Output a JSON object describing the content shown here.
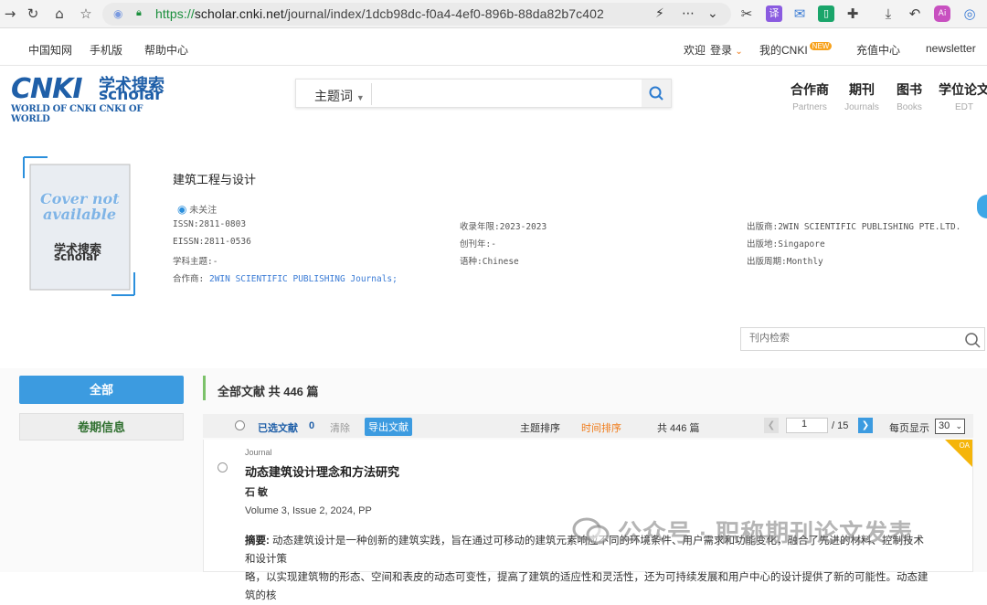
{
  "browser": {
    "url_proto": "https://",
    "url_host": "scholar.cnki.net",
    "url_path": "/journal/index/1dcb98dc-f0a4-4ef0-896b-88da82b7c402"
  },
  "topnav": {
    "items": [
      "中国知网",
      "手机版",
      "帮助中心"
    ],
    "welcome": "欢迎",
    "login": "登录",
    "mycnki": "我的CNKI",
    "new_badge": "NEW",
    "recharge": "充值中心",
    "newsletter": "newsletter"
  },
  "logo": {
    "main": "CNKI",
    "cn": "学术搜索",
    "sub": "scholar",
    "tagline": "WORLD OF CNKI CNKI OF WORLD"
  },
  "search": {
    "type": "主题词",
    "placeholder": ""
  },
  "nav_tabs": [
    {
      "cn": "合作商",
      "en": "Partners"
    },
    {
      "cn": "期刊",
      "en": "Journals"
    },
    {
      "cn": "图书",
      "en": "Books"
    },
    {
      "cn": "学位论文",
      "en": "EDT"
    }
  ],
  "cover": {
    "line1": "Cover not",
    "line2": "available",
    "logo_cn": "学术搜索",
    "logo_en": "scholar"
  },
  "journal": {
    "title": "建筑工程与设计",
    "follow": "未关注",
    "issn": "ISSN:2811-0803",
    "eissn": "EISSN:2811-0536",
    "subject": "学科主题:-",
    "partner_label": "合作商:",
    "partner_value": "2WIN SCIENTIFIC PUBLISHING Journals;",
    "years": "收录年限:2023-2023",
    "founded": "创刊年:-",
    "language": "语种:Chinese",
    "publisher": "出版商:2WIN SCIENTIFIC PUBLISHING PTE.LTD.",
    "place": "出版地:Singapore",
    "frequency": "出版周期:Monthly"
  },
  "inner_search": {
    "placeholder": "刊内检索"
  },
  "sidebar": {
    "all": "全部",
    "volumes": "卷期信息"
  },
  "list": {
    "title": "全部文献 共 446 篇",
    "selected_label": "已选文献",
    "selected_count": "0",
    "clear": "清除",
    "export": "导出文献",
    "sort_topic": "主题排序",
    "sort_time": "时间排序",
    "total": "共 446 篇",
    "page": "1",
    "page_total": "/ 15",
    "per_page_label": "每页显示",
    "per_page": "30"
  },
  "article": {
    "oa": "OA",
    "type": "Journal",
    "title": "动态建筑设计理念和方法研究",
    "author": "石 敏",
    "volume": "Volume 3, Issue 2, 2024, PP",
    "abstract_label": "摘要:",
    "abstract_line1": " 动态建筑设计是一种创新的建筑实践，旨在通过可移动的建筑元素响应不同的环境条件、用户需求和功能变化，融合了先进的材料、控制技术和设计策",
    "abstract_line2": "略，以实现建筑物的形态、空间和表皮的动态可变性，提高了建筑的适应性和灵活性，还为可持续发展和用户中心的设计提供了新的可能性。动态建筑的核"
  },
  "watermark": "公众号 · 职称期刊论文发表",
  "colors": {
    "accent": "#3c9be0",
    "orange": "#f07c1b",
    "green_bar": "#7cc26a",
    "oa_tag": "#f5b50a"
  }
}
